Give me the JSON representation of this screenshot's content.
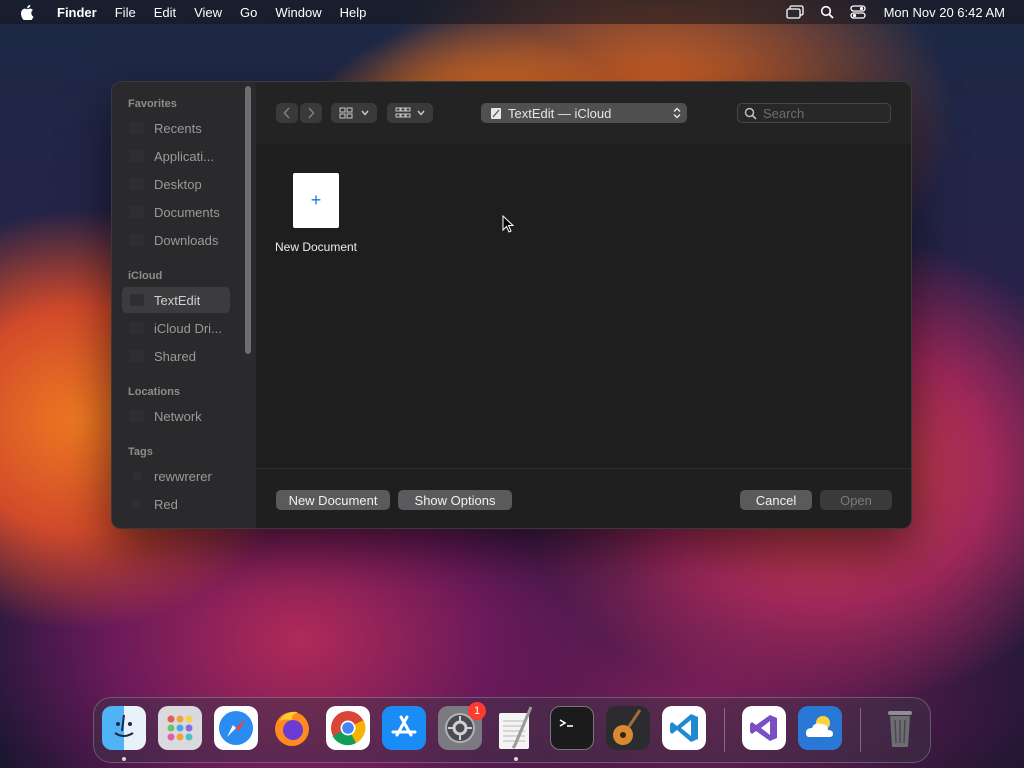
{
  "menubar": {
    "app_name": "Finder",
    "items": [
      "File",
      "Edit",
      "View",
      "Go",
      "Window",
      "Help"
    ],
    "clock": "Mon Nov 20  6:42 AM",
    "status_icons": [
      "screen-mirroring-icon",
      "spotlight-search-icon",
      "control-center-icon"
    ]
  },
  "dialog": {
    "sidebar": {
      "favorites_header": "Favorites",
      "favorites": [
        "Recents",
        "Applicati...",
        "Desktop",
        "Documents",
        "Downloads"
      ],
      "icloud_header": "iCloud",
      "icloud": [
        "TextEdit",
        "iCloud Dri...",
        "Shared"
      ],
      "selected": "TextEdit",
      "locations_header": "Locations",
      "locations": [
        "Network"
      ],
      "tags_header": "Tags",
      "tags": [
        "rewwrerer",
        "Red"
      ]
    },
    "toolbar": {
      "location_label": "TextEdit — iCloud",
      "search_placeholder": "Search"
    },
    "content": {
      "new_document_label": "New Document",
      "new_document_glyph": "+"
    },
    "buttons": {
      "new_document": "New Document",
      "show_options": "Show Options",
      "cancel": "Cancel",
      "open": "Open"
    }
  },
  "dock": {
    "apps": [
      "Finder",
      "Launchpad",
      "Safari",
      "Firefox",
      "Chrome",
      "App Store",
      "System Settings",
      "TextEdit",
      "Terminal",
      "GarageBand",
      "Visual Studio Code",
      "Visual Studio",
      "Weather",
      "Trash"
    ],
    "system_settings_badge": "1"
  }
}
